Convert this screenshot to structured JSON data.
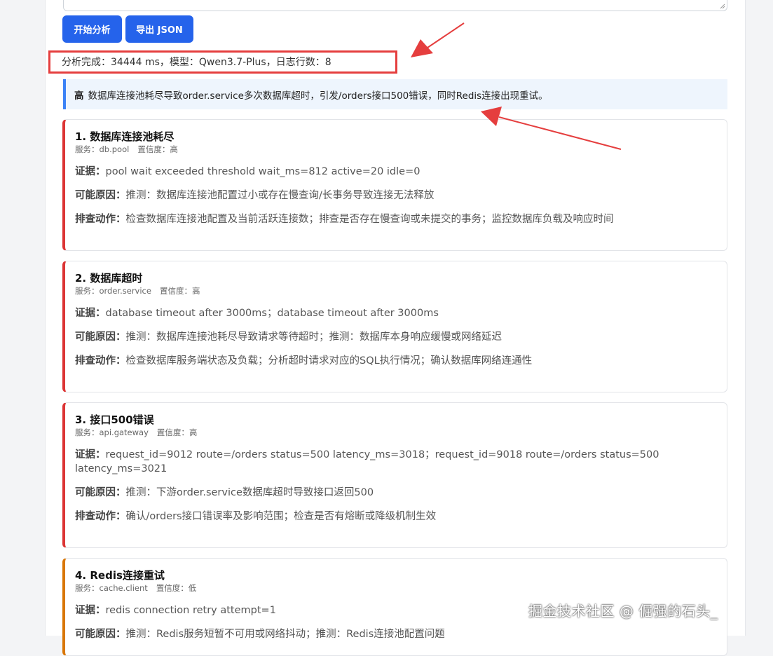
{
  "toolbar": {
    "start_label": "开始分析",
    "export_label": "导出 JSON"
  },
  "status": {
    "text": "分析完成：34444 ms，模型：Qwen3.7-Plus，日志行数：8"
  },
  "summary": {
    "level": "高",
    "text": "数据库连接池耗尽导致order.service多次数据库超时，引发/orders接口500错误，同时Redis连接出现重试。"
  },
  "findings": [
    {
      "title": "1. 数据库连接池耗尽",
      "service": "服务：db.pool",
      "confidence": "置信度：高",
      "evidence_label": "证据：",
      "evidence": "pool wait exceeded threshold wait_ms=812 active=20 idle=0",
      "cause_label": "可能原因：",
      "cause": "推测：数据库连接池配置过小或存在慢查询/长事务导致连接无法释放",
      "action_label": "排查动作：",
      "action": "检查数据库连接池配置及当前活跃连接数；排查是否存在慢查询或未提交的事务；监控数据库负载及响应时间"
    },
    {
      "title": "2. 数据库超时",
      "service": "服务：order.service",
      "confidence": "置信度：高",
      "evidence_label": "证据：",
      "evidence": "database timeout after 3000ms；database timeout after 3000ms",
      "cause_label": "可能原因：",
      "cause": "推测：数据库连接池耗尽导致请求等待超时；推测：数据库本身响应缓慢或网络延迟",
      "action_label": "排查动作：",
      "action": "检查数据库服务端状态及负载；分析超时请求对应的SQL执行情况；确认数据库网络连通性"
    },
    {
      "title": "3. 接口500错误",
      "service": "服务：api.gateway",
      "confidence": "置信度：高",
      "evidence_label": "证据：",
      "evidence": "request_id=9012 route=/orders status=500 latency_ms=3018；request_id=9018 route=/orders status=500 latency_ms=3021",
      "cause_label": "可能原因：",
      "cause": "推测：下游order.service数据库超时导致接口返回500",
      "action_label": "排查动作：",
      "action": "确认/orders接口错误率及影响范围；检查是否有熔断或降级机制生效"
    },
    {
      "title": "4. Redis连接重试",
      "service": "服务：cache.client",
      "confidence": "置信度：低",
      "evidence_label": "证据：",
      "evidence": "redis connection retry attempt=1",
      "cause_label": "可能原因：",
      "cause": "推测：Redis服务短暂不可用或网络抖动；推测：Redis连接池配置问题"
    }
  ],
  "watermark": "掘金技术社区 @ 倔强的石头_",
  "colors": {
    "primary": "#2563eb",
    "severity_high": "#dc3535",
    "severity_low": "#d97706",
    "annotation": "#e53e3e"
  }
}
